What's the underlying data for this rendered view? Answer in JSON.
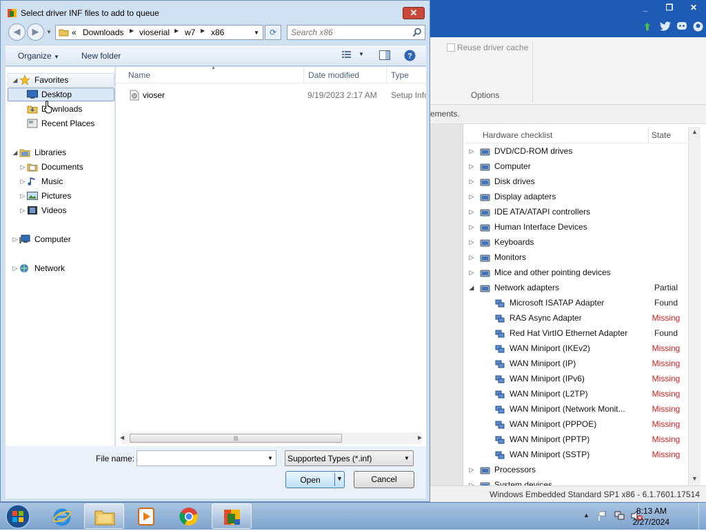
{
  "background_app": {
    "reuse_cache_label": "Reuse driver cache",
    "options_label": "Options",
    "message_partial": "ements.",
    "hardware_header": "Hardware checklist",
    "state_header": "State",
    "hardware_items": [
      {
        "label": "DVD/CD-ROM drives",
        "state": "",
        "expand": "collapsed",
        "child": false
      },
      {
        "label": "Computer",
        "state": "",
        "expand": "collapsed",
        "child": false
      },
      {
        "label": "Disk drives",
        "state": "",
        "expand": "collapsed",
        "child": false
      },
      {
        "label": "Display adapters",
        "state": "",
        "expand": "collapsed",
        "child": false
      },
      {
        "label": "IDE ATA/ATAPI controllers",
        "state": "",
        "expand": "collapsed",
        "child": false
      },
      {
        "label": "Human Interface Devices",
        "state": "",
        "expand": "collapsed",
        "child": false
      },
      {
        "label": "Keyboards",
        "state": "",
        "expand": "collapsed",
        "child": false
      },
      {
        "label": "Monitors",
        "state": "",
        "expand": "collapsed",
        "child": false
      },
      {
        "label": "Mice and other pointing devices",
        "state": "",
        "expand": "collapsed",
        "child": false
      },
      {
        "label": "Network adapters",
        "state": "Partial",
        "expand": "expanded",
        "child": false
      },
      {
        "label": "Microsoft ISATAP Adapter",
        "state": "Found",
        "expand": "none",
        "child": true
      },
      {
        "label": "RAS Async Adapter",
        "state": "Missing",
        "expand": "none",
        "child": true
      },
      {
        "label": "Red Hat VirtIO Ethernet Adapter",
        "state": "Found",
        "expand": "none",
        "child": true
      },
      {
        "label": "WAN Miniport (IKEv2)",
        "state": "Missing",
        "expand": "none",
        "child": true
      },
      {
        "label": "WAN Miniport (IP)",
        "state": "Missing",
        "expand": "none",
        "child": true
      },
      {
        "label": "WAN Miniport (IPv6)",
        "state": "Missing",
        "expand": "none",
        "child": true
      },
      {
        "label": "WAN Miniport (L2TP)",
        "state": "Missing",
        "expand": "none",
        "child": true
      },
      {
        "label": "WAN Miniport (Network Monit...",
        "state": "Missing",
        "expand": "none",
        "child": true
      },
      {
        "label": "WAN Miniport (PPPOE)",
        "state": "Missing",
        "expand": "none",
        "child": true
      },
      {
        "label": "WAN Miniport (PPTP)",
        "state": "Missing",
        "expand": "none",
        "child": true
      },
      {
        "label": "WAN Miniport (SSTP)",
        "state": "Missing",
        "expand": "none",
        "child": true
      },
      {
        "label": "Processors",
        "state": "",
        "expand": "collapsed",
        "child": false
      },
      {
        "label": "System devices",
        "state": "",
        "expand": "collapsed",
        "child": false
      }
    ],
    "status_text": "Windows Embedded Standard SP1 x86 - 6.1.7601.17514",
    "colors": {
      "title_bar": "#1e5bb5",
      "missing": "#d02020",
      "found": "#222222"
    }
  },
  "dialog": {
    "title": "Select driver INF files to add to queue",
    "breadcrumb": {
      "overflow": "«",
      "parts": [
        "Downloads",
        "vioserial",
        "w7",
        "x86"
      ]
    },
    "search_placeholder": "Search x86",
    "toolbar": {
      "organize": "Organize",
      "new_folder": "New folder"
    },
    "nav": {
      "favorites": "Favorites",
      "desktop": "Desktop",
      "downloads": "Downloads",
      "recent_places": "Recent Places",
      "libraries": "Libraries",
      "documents": "Documents",
      "music": "Music",
      "pictures": "Pictures",
      "videos": "Videos",
      "computer": "Computer",
      "network": "Network"
    },
    "columns": {
      "name": "Name",
      "date_modified": "Date modified",
      "type": "Type"
    },
    "files": [
      {
        "name": "vioser",
        "date": "9/19/2023 2:17 AM",
        "type": "Setup Information"
      }
    ],
    "file_name_label": "File name:",
    "file_name_value": "",
    "filter": "Supported Types (*.inf)",
    "open_button": "Open",
    "cancel_button": "Cancel"
  },
  "taskbar": {
    "time": "8:13 AM",
    "date": "2/27/2024"
  }
}
